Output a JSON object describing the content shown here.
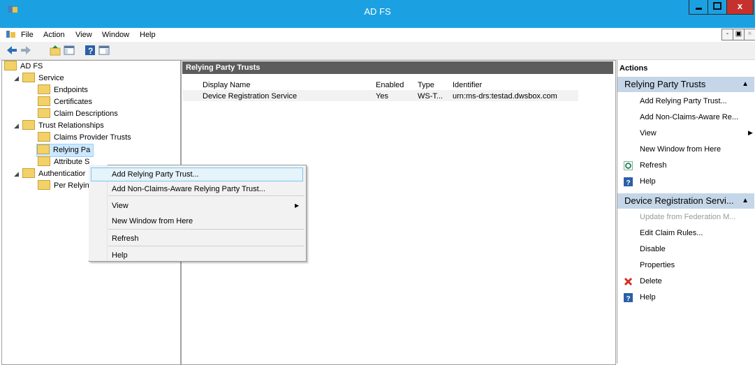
{
  "window": {
    "title": "AD FS",
    "close_label": "x"
  },
  "menubar": {
    "items": [
      "File",
      "Action",
      "View",
      "Window",
      "Help"
    ],
    "mdi": [
      "-",
      "▣",
      "×"
    ]
  },
  "tree": {
    "root": "AD FS",
    "service": "Service",
    "endpoints": "Endpoints",
    "certificates": "Certificates",
    "claim_descriptions": "Claim Descriptions",
    "trust_relationships": "Trust Relationships",
    "claims_provider_trusts": "Claims Provider Trusts",
    "relying_party_trusts": "Relying Pa",
    "attribute_stores": "Attribute S",
    "authentication": "Authenticatior",
    "per_relying": "Per Relying"
  },
  "center": {
    "header": "Relying Party Trusts",
    "columns": [
      "Display Name",
      "Enabled",
      "Type",
      "Identifier"
    ],
    "rows": [
      {
        "display_name": "Device Registration Service",
        "enabled": "Yes",
        "type": "WS-T...",
        "identifier": "urn:ms-drs:testad.dwsbox.com"
      }
    ]
  },
  "context_menu": {
    "items": [
      "Add Relying Party Trust...",
      "Add Non-Claims-Aware Relying Party Trust...",
      "View",
      "New Window from Here",
      "Refresh",
      "Help"
    ]
  },
  "actions": {
    "title": "Actions",
    "section1": {
      "header": "Relying Party Trusts",
      "items": [
        "Add Relying Party Trust...",
        "Add Non-Claims-Aware Re...",
        "View",
        "New Window from Here",
        "Refresh",
        "Help"
      ]
    },
    "section2": {
      "header": "Device Registration Servi...",
      "items": [
        "Update from Federation M...",
        "Edit Claim Rules...",
        "Disable",
        "Properties",
        "Delete",
        "Help"
      ]
    }
  },
  "colors": {
    "titlebar": "#1ba1e2",
    "close": "#c7312d",
    "action_header": "#c5d6e8",
    "pane_header": "#5c5c5c"
  }
}
